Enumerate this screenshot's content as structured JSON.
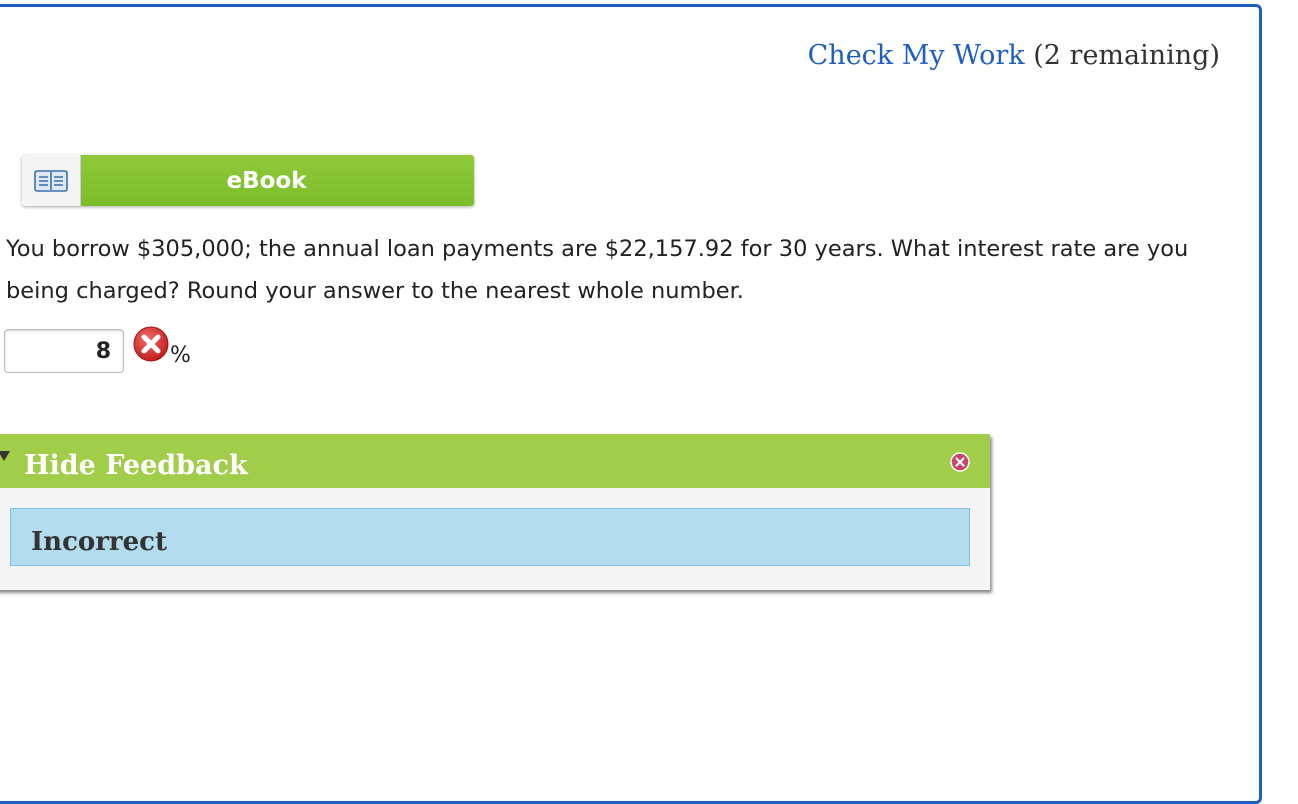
{
  "header": {
    "check_work_link": "Check My Work",
    "remaining": "(2 remaining)"
  },
  "ebook": {
    "label": "eBook",
    "icon": "open-book-icon"
  },
  "question": {
    "text": "You borrow $305,000; the annual loan payments are $22,157.92 for 30 years. What interest rate are you being charged? Round your answer to the nearest whole number."
  },
  "answer": {
    "value": "8",
    "unit": "%",
    "status_icon": "incorrect-x-icon"
  },
  "feedback": {
    "toggle_label": "Hide Feedback",
    "status": "Incorrect",
    "close_icon": "close-icon"
  },
  "colors": {
    "accent_blue": "#1f5fbf",
    "ebook_green": "#7cbd2a",
    "feedback_green": "#a2cd4a",
    "feedback_body": "#b3dcee",
    "error_red": "#d62b2b"
  }
}
